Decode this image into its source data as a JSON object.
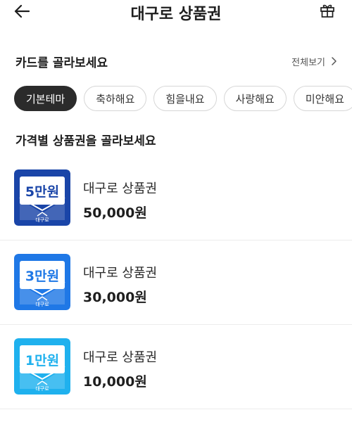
{
  "header": {
    "title": "대구로 상품권"
  },
  "cards": {
    "title": "카드를 골라보세요",
    "see_all": "전체보기",
    "chips": [
      {
        "label": "기본테마",
        "active": true
      },
      {
        "label": "축하해요",
        "active": false
      },
      {
        "label": "힘을내요",
        "active": false
      },
      {
        "label": "사랑해요",
        "active": false
      },
      {
        "label": "미안해요",
        "active": false
      }
    ]
  },
  "products": {
    "title": "가격별 상품권을 골라보세요",
    "items": [
      {
        "name": "대구로 상품권",
        "price": "50,000원",
        "badge": "5만원",
        "brand": "대구로",
        "color": "#1a45a8"
      },
      {
        "name": "대구로 상품권",
        "price": "30,000원",
        "badge": "3만원",
        "brand": "대구로",
        "color": "#1f78e6"
      },
      {
        "name": "대구로 상품권",
        "price": "10,000원",
        "badge": "1만원",
        "brand": "대구로",
        "color": "#1fb1ee"
      }
    ]
  }
}
